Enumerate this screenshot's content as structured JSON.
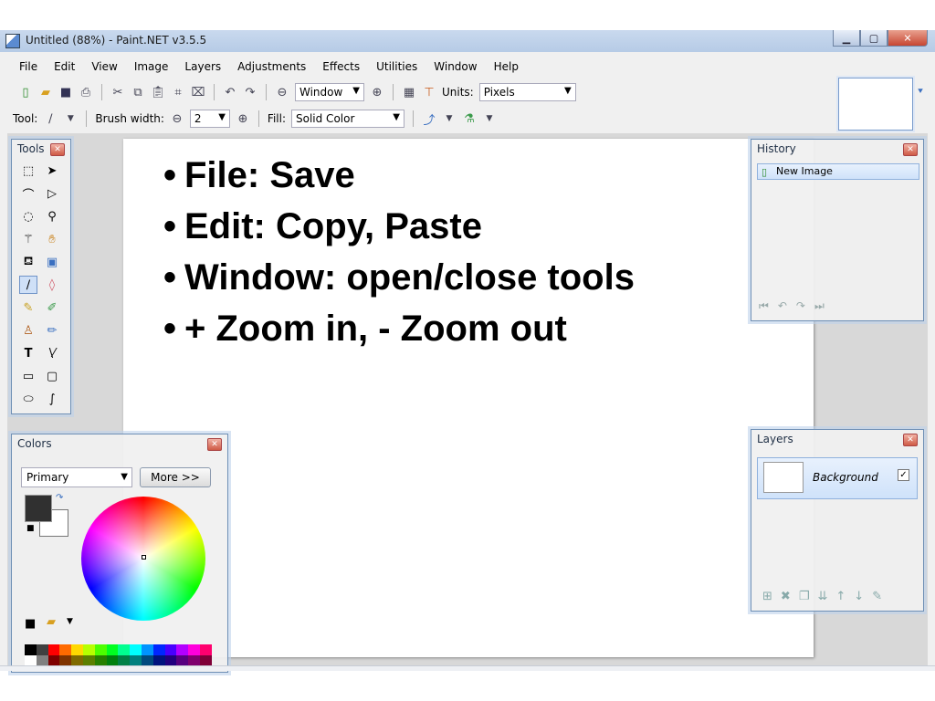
{
  "window": {
    "title": "Untitled (88%) - Paint.NET v3.5.5"
  },
  "menu": [
    "File",
    "Edit",
    "View",
    "Image",
    "Layers",
    "Adjustments",
    "Effects",
    "Utilities",
    "Window",
    "Help"
  ],
  "toolbar": {
    "zoom_value": "Window",
    "units_label": "Units:",
    "units_value": "Pixels"
  },
  "toolbar2": {
    "tool_label": "Tool:",
    "brush_width_label": "Brush width:",
    "brush_width_value": "2",
    "fill_label": "Fill:",
    "fill_value": "Solid Color"
  },
  "slide": {
    "bullets": [
      "File: Save",
      "Edit: Copy, Paste",
      "Window: open/close tools",
      "+ Zoom in, - Zoom out"
    ]
  },
  "tools_panel": {
    "title": "Tools",
    "tools": [
      "rectangle-select-icon",
      "move-selection-icon",
      "lasso-select-icon",
      "move-selection-alt-icon",
      "ellipse-select-icon",
      "zoom-icon",
      "magic-wand-icon",
      "pan-icon",
      "paint-bucket-icon",
      "gradient-icon",
      "paintbrush-icon",
      "eraser-icon",
      "pencil-icon",
      "color-picker-icon",
      "clone-stamp-icon",
      "recolor-icon",
      "text-icon",
      "line-curve-icon",
      "rectangle-icon",
      "rounded-rectangle-icon",
      "ellipse-icon",
      "freeform-shape-icon"
    ]
  },
  "history_panel": {
    "title": "History",
    "items": [
      "New Image"
    ]
  },
  "layers_panel": {
    "title": "Layers",
    "layers": [
      {
        "name": "Background",
        "visible": true
      }
    ]
  },
  "colors_panel": {
    "title": "Colors",
    "mode": "Primary",
    "more_button": "More >>",
    "primary_color": "#303030",
    "secondary_color": "#ffffff",
    "palette": [
      "#000000",
      "#404040",
      "#ff0000",
      "#ff6a00",
      "#ffd800",
      "#b6ff00",
      "#4cff00",
      "#00ff21",
      "#00ff90",
      "#00ffff",
      "#0094ff",
      "#0026ff",
      "#4800ff",
      "#b200ff",
      "#ff00dc",
      "#ff006e",
      "#ffffff",
      "#808080",
      "#7f0000",
      "#7f3300",
      "#7f6a00",
      "#5b7f00",
      "#267f00",
      "#007f0e",
      "#007f46",
      "#007f7f",
      "#004a7f",
      "#00137f",
      "#21007f",
      "#57007f",
      "#7f006e",
      "#7f0037"
    ]
  }
}
